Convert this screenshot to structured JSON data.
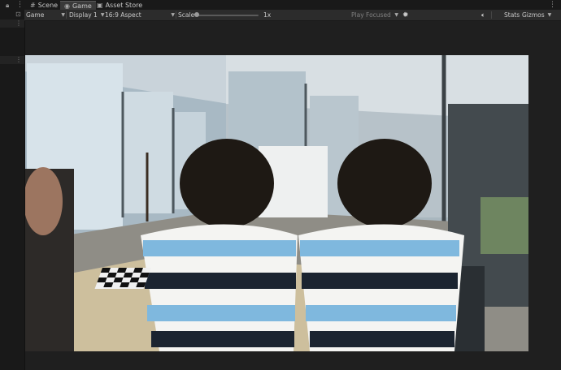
{
  "tabs": [
    {
      "label": "Scene",
      "icon": "scene-icon"
    },
    {
      "label": "Game",
      "icon": "game-icon"
    },
    {
      "label": "Asset Store",
      "icon": "asset-store-icon"
    }
  ],
  "toolbar": {
    "mode": "Game",
    "display": "Display 1",
    "aspect": "16:9 Aspect",
    "scale_label": "Scale",
    "scale_value": "1x",
    "play_mode": "Play Focused",
    "stats": "Stats",
    "gizmos": "Gizmos"
  },
  "icons": {
    "lock": "lock-icon",
    "menu": "kebab-menu-icon",
    "audio": "speaker-icon",
    "bug": "bug-icon",
    "dropdown": "chevron-down-icon"
  },
  "colors": {
    "background": "#1e1e1e",
    "toolbar": "#2c2c2c",
    "active_tab": "#3a3a3a"
  }
}
